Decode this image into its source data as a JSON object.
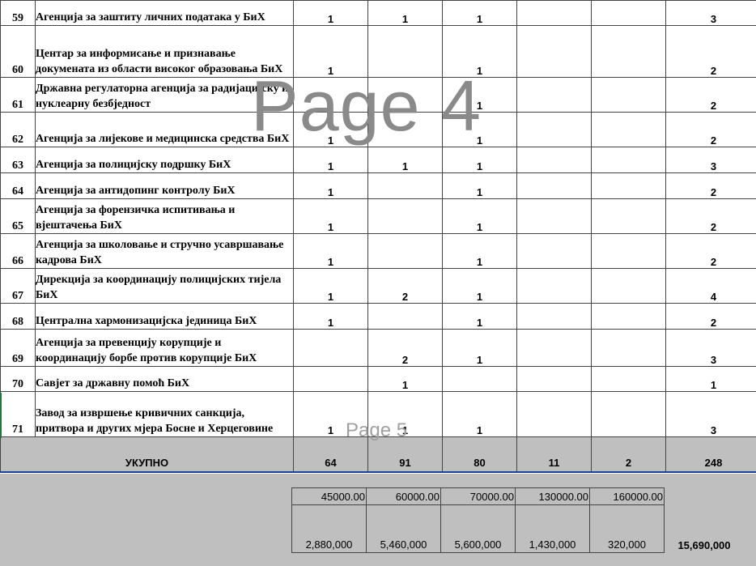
{
  "rows": [
    {
      "num": "59",
      "name": "Агенција за заштиту личних података у БиХ",
      "c1": "1",
      "c2": "1",
      "c3": "1",
      "c4": "",
      "c5": "",
      "total": "3"
    },
    {
      "num": "60",
      "name": "Центар за информисање и признавање докумената из области високог образовања БиХ",
      "c1": "1",
      "c2": "",
      "c3": "1",
      "c4": "",
      "c5": "",
      "total": "2"
    },
    {
      "num": "61",
      "name": "Државна регулаторна агенција за радијацијску и нуклеарну безбједност",
      "c1": "1",
      "c2": "",
      "c3": "1",
      "c4": "",
      "c5": "",
      "total": "2"
    },
    {
      "num": "62",
      "name": "Агенција за лијекове и медицинска средства БиХ",
      "c1": "1",
      "c2": "",
      "c3": "1",
      "c4": "",
      "c5": "",
      "total": "2"
    },
    {
      "num": "63",
      "name": "Агенција за полицијску подршку БиХ",
      "c1": "1",
      "c2": "1",
      "c3": "1",
      "c4": "",
      "c5": "",
      "total": "3"
    },
    {
      "num": "64",
      "name": "Агенција за антидопинг контролу БиХ",
      "c1": "1",
      "c2": "",
      "c3": "1",
      "c4": "",
      "c5": "",
      "total": "2"
    },
    {
      "num": "65",
      "name": "Агенција за форензичка испитивања и вјештачења БиХ",
      "c1": "1",
      "c2": "",
      "c3": "1",
      "c4": "",
      "c5": "",
      "total": "2"
    },
    {
      "num": "66",
      "name": "Агенција за школовање и стручно усавршавање кадрова БиХ",
      "c1": "1",
      "c2": "",
      "c3": "1",
      "c4": "",
      "c5": "",
      "total": "2"
    },
    {
      "num": "67",
      "name": "Дирекција за координацију полицијских тијела БиХ",
      "c1": "1",
      "c2": "2",
      "c3": "1",
      "c4": "",
      "c5": "",
      "total": "4"
    },
    {
      "num": "68",
      "name": "Централна хармонизацијска јединица БиХ",
      "c1": "1",
      "c2": "",
      "c3": "1",
      "c4": "",
      "c5": "",
      "total": "2"
    },
    {
      "num": "69",
      "name": "Агенција за превенцију корупције и координацију борбе против корупције БиХ",
      "c1": "",
      "c2": "2",
      "c3": "1",
      "c4": "",
      "c5": "",
      "total": "3"
    },
    {
      "num": "70",
      "name": "Савјет за државну помоћ БиХ",
      "c1": "",
      "c2": "1",
      "c3": "",
      "c4": "",
      "c5": "",
      "total": "1"
    },
    {
      "num": "71",
      "name": "Завод за извршење кривичних санкција, притвора и других мјера Босне и Херцеговине",
      "c1": "1",
      "c2": "1",
      "c3": "1",
      "c4": "",
      "c5": "",
      "total": "3"
    }
  ],
  "totals": {
    "label": "УКУПНО",
    "c1": "64",
    "c2": "91",
    "c3": "80",
    "c4": "11",
    "c5": "2",
    "total": "248"
  },
  "prices": [
    "45000.00",
    "60000.00",
    "70000.00",
    "130000.00",
    "160000.00"
  ],
  "amounts": [
    "2,880,000",
    "5,460,000",
    "5,600,000",
    "1,430,000",
    "320,000"
  ],
  "grand_total": "15,690,000",
  "watermarks": {
    "big": "Page 4",
    "small": "Page 5"
  }
}
